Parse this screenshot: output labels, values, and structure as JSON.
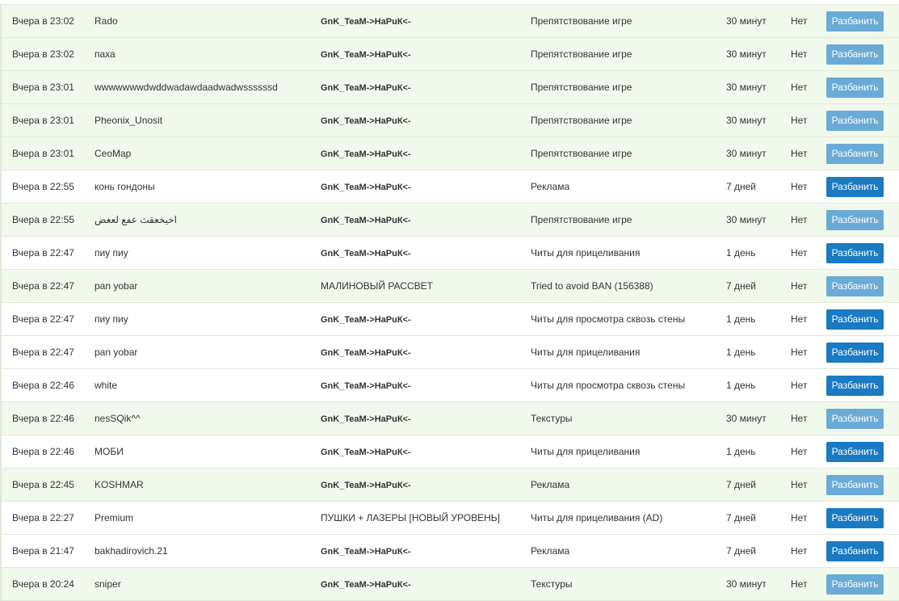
{
  "bans": [
    {
      "date": "Вчера в 23:02",
      "player": "Rado",
      "admin": "GnK_TeaM->НаРuК<-",
      "admin_bold": true,
      "reason": "Препятствование игре",
      "term": "30 минут",
      "unbanned": "Нет",
      "action_label": "Разбанить",
      "active": false
    },
    {
      "date": "Вчера в 23:02",
      "player": "паха",
      "admin": "GnK_TeaM->НаРuК<-",
      "admin_bold": true,
      "reason": "Препятствование игре",
      "term": "30 минут",
      "unbanned": "Нет",
      "action_label": "Разбанить",
      "active": false
    },
    {
      "date": "Вчера в 23:01",
      "player": "wwwwwwwdwddwadawdaadwadwssssssd",
      "admin": "GnK_TeaM->НаРuК<-",
      "admin_bold": true,
      "reason": "Препятствование игре",
      "term": "30 минут",
      "unbanned": "Нет",
      "action_label": "Разбанить",
      "active": false
    },
    {
      "date": "Вчера в 23:01",
      "player": "Pheonix_Unosit",
      "admin": "GnK_TeaM->НаРuК<-",
      "admin_bold": true,
      "reason": "Препятствование игре",
      "term": "30 минут",
      "unbanned": "Нет",
      "action_label": "Разбанить",
      "active": false
    },
    {
      "date": "Вчера в 23:01",
      "player": "CeoMap",
      "admin": "GnK_TeaM->НаРuК<-",
      "admin_bold": true,
      "reason": "Препятствование игре",
      "term": "30 минут",
      "unbanned": "Нет",
      "action_label": "Разбанить",
      "active": false
    },
    {
      "date": "Вчера в 22:55",
      "player": "конь гондоны",
      "admin": "GnK_TeaM->НаРuК<-",
      "admin_bold": true,
      "reason": "Реклама",
      "term": "7 дней",
      "unbanned": "Нет",
      "action_label": "Разбанить",
      "active": true
    },
    {
      "date": "Вчера в 22:55",
      "player": "اخيخعقث عفع لعغض",
      "admin": "GnK_TeaM->НаРuК<-",
      "admin_bold": true,
      "reason": "Препятствование игре",
      "term": "30 минут",
      "unbanned": "Нет",
      "action_label": "Разбанить",
      "active": false
    },
    {
      "date": "Вчера в 22:47",
      "player": "пиу пиу",
      "admin": "GnK_TeaM->НаРuК<-",
      "admin_bold": true,
      "reason": "Читы для прицеливания",
      "term": "1 день",
      "unbanned": "Нет",
      "action_label": "Разбанить",
      "active": true
    },
    {
      "date": "Вчера в 22:47",
      "player": "pan yobar",
      "admin": "МАЛИНОВЫЙ РАССВЕТ",
      "admin_bold": false,
      "reason": "Tried to avoid BAN (156388)",
      "term": "7 дней",
      "unbanned": "Нет",
      "action_label": "Разбанить",
      "active": false
    },
    {
      "date": "Вчера в 22:47",
      "player": "пиу пиу",
      "admin": "GnK_TeaM->НаРuК<-",
      "admin_bold": true,
      "reason": "Читы для просмотра сквозь стены",
      "term": "1 день",
      "unbanned": "Нет",
      "action_label": "Разбанить",
      "active": true
    },
    {
      "date": "Вчера в 22:47",
      "player": "pan yobar",
      "admin": "GnK_TeaM->НаРuК<-",
      "admin_bold": true,
      "reason": "Читы для прицеливания",
      "term": "1 день",
      "unbanned": "Нет",
      "action_label": "Разбанить",
      "active": true
    },
    {
      "date": "Вчера в 22:46",
      "player": "white",
      "admin": "GnK_TeaM->НаРuК<-",
      "admin_bold": true,
      "reason": "Читы для просмотра сквозь стены",
      "term": "1 день",
      "unbanned": "Нет",
      "action_label": "Разбанить",
      "active": true
    },
    {
      "date": "Вчера в 22:46",
      "player": "nesSQik^^",
      "admin": "GnK_TeaM->НаРuК<-",
      "admin_bold": true,
      "reason": "Текстуры",
      "term": "30 минут",
      "unbanned": "Нет",
      "action_label": "Разбанить",
      "active": false
    },
    {
      "date": "Вчера в 22:46",
      "player": "МОБИ",
      "admin": "GnK_TeaM->НаРuК<-",
      "admin_bold": true,
      "reason": "Читы для прицеливания",
      "term": "1 день",
      "unbanned": "Нет",
      "action_label": "Разбанить",
      "active": true
    },
    {
      "date": "Вчера в 22:45",
      "player": "KOSHMAR",
      "admin": "GnK_TeaM->НаРuК<-",
      "admin_bold": true,
      "reason": "Реклама",
      "term": "7 дней",
      "unbanned": "Нет",
      "action_label": "Разбанить",
      "active": false
    },
    {
      "date": "Вчера в 22:27",
      "player": "Premium",
      "admin": "ПУШКИ + ЛАЗЕРЫ [НОВЫЙ УРОВЕНЬ]",
      "admin_bold": false,
      "reason": "Читы для прицеливания (AD)",
      "term": "7 дней",
      "unbanned": "Нет",
      "action_label": "Разбанить",
      "active": true
    },
    {
      "date": "Вчера в 21:47",
      "player": "bakhadirovich.21",
      "admin": "GnK_TeaM->НаРuК<-",
      "admin_bold": true,
      "reason": "Реклама",
      "term": "7 дней",
      "unbanned": "Нет",
      "action_label": "Разбанить",
      "active": true
    },
    {
      "date": "Вчера в 20:24",
      "player": "sniper",
      "admin": "GnK_TeaM->НаРuК<-",
      "admin_bold": true,
      "reason": "Текстуры",
      "term": "30 минут",
      "unbanned": "Нет",
      "action_label": "Разбанить",
      "active": false
    }
  ]
}
